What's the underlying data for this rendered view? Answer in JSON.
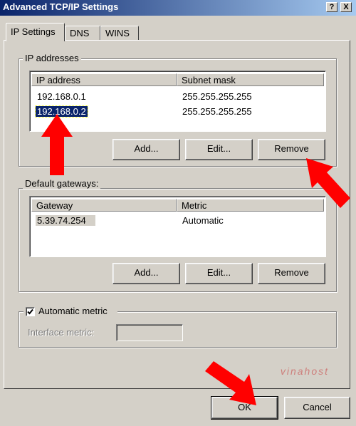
{
  "window": {
    "title": "Advanced TCP/IP Settings",
    "help_btn": "?",
    "close_btn": "X"
  },
  "tabs": [
    {
      "label": "IP Settings"
    },
    {
      "label": "DNS"
    },
    {
      "label": "WINS"
    }
  ],
  "ip_group": {
    "title": "IP addresses",
    "columns": [
      "IP address",
      "Subnet mask"
    ],
    "rows": [
      {
        "ip": "192.168.0.1",
        "mask": "255.255.255.255"
      },
      {
        "ip": "192.168.0.2",
        "mask": "255.255.255.255",
        "selected": true
      }
    ],
    "buttons": {
      "add": "Add...",
      "edit": "Edit...",
      "remove": "Remove"
    }
  },
  "gateway_group": {
    "title": "Default gateways:",
    "columns": [
      "Gateway",
      "Metric"
    ],
    "rows": [
      {
        "gateway": "5.39.74.254",
        "metric": "Automatic"
      }
    ],
    "buttons": {
      "add": "Add...",
      "edit": "Edit...",
      "remove": "Remove"
    }
  },
  "metric_group": {
    "checkbox_label": "Automatic metric",
    "checkbox_checked": true,
    "interface_metric_label": "Interface metric:",
    "interface_metric_value": ""
  },
  "footer": {
    "ok": "OK",
    "cancel": "Cancel"
  },
  "watermark": "vinahost",
  "colors": {
    "annotation_arrow": "#ff0000",
    "selection": "#0a246a",
    "titlebar": "#0a246a"
  }
}
